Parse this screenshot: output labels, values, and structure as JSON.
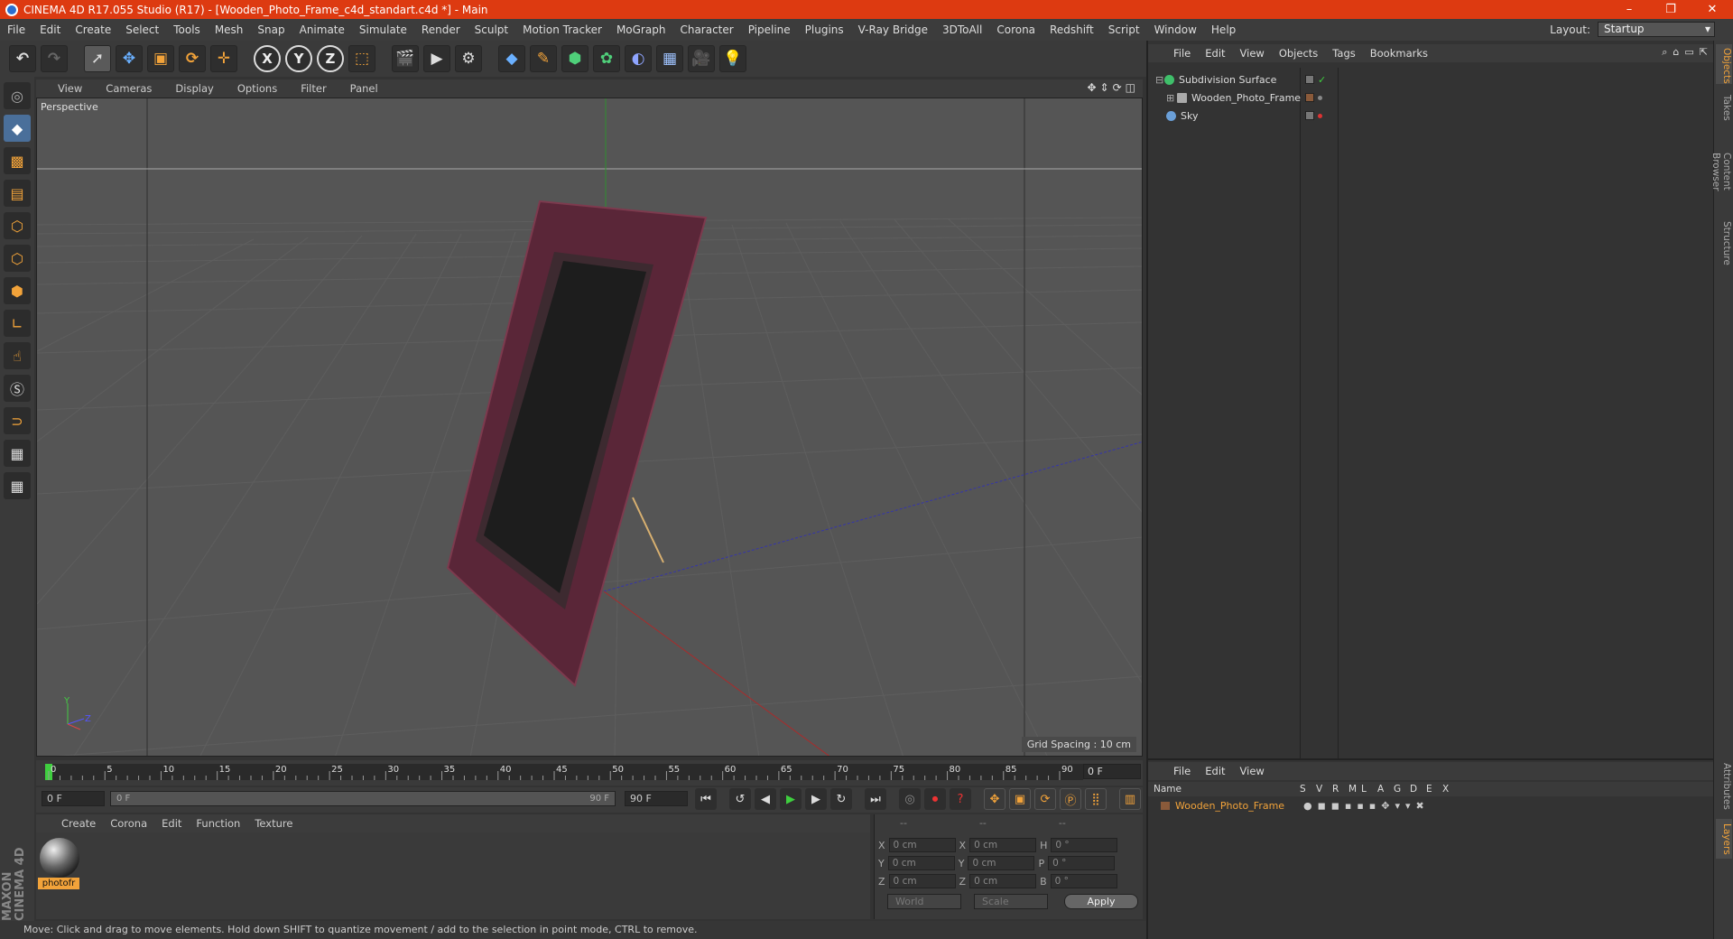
{
  "titlebar": {
    "title": "CINEMA 4D R17.055 Studio (R17) - [Wooden_Photo_Frame_c4d_standart.c4d *] - Main",
    "minimize": "–",
    "maximize": "❐",
    "close": "✕"
  },
  "menubar": {
    "items": [
      "File",
      "Edit",
      "Create",
      "Select",
      "Tools",
      "Mesh",
      "Snap",
      "Animate",
      "Simulate",
      "Render",
      "Sculpt",
      "Motion Tracker",
      "MoGraph",
      "Character",
      "Pipeline",
      "Plugins",
      "V-Ray Bridge",
      "3DToAll",
      "Corona",
      "Redshift",
      "Script",
      "Window",
      "Help"
    ],
    "layout_label": "Layout:",
    "layout_value": "Startup"
  },
  "toolbar": {
    "axis_x": "X",
    "axis_y": "Y",
    "axis_z": "Z"
  },
  "viewport": {
    "menu": [
      "View",
      "Cameras",
      "Display",
      "Options",
      "Filter",
      "Panel"
    ],
    "label": "Perspective",
    "grid_spacing": "Grid Spacing : 10 cm",
    "axis_y": "Y",
    "axis_z": "Z"
  },
  "timeline": {
    "ticks": [
      "0",
      "5",
      "10",
      "15",
      "20",
      "25",
      "30",
      "35",
      "40",
      "45",
      "50",
      "55",
      "60",
      "65",
      "70",
      "75",
      "80",
      "85",
      "90"
    ],
    "current_frame": "0 F"
  },
  "transport": {
    "start_frame": "0 F",
    "slider_left": "0 F",
    "slider_right": "90 F",
    "end_frame": "90 F"
  },
  "material": {
    "menu": [
      "Create",
      "Corona",
      "Edit",
      "Function",
      "Texture"
    ],
    "name": "photofr"
  },
  "coords": {
    "header": [
      "--",
      "--",
      "--"
    ],
    "rows": [
      {
        "a": "X",
        "v1": "0 cm",
        "b": "X",
        "v2": "0 cm",
        "c": "H",
        "v3": "0 °"
      },
      {
        "a": "Y",
        "v1": "0 cm",
        "b": "Y",
        "v2": "0 cm",
        "c": "P",
        "v3": "0 °"
      },
      {
        "a": "Z",
        "v1": "0 cm",
        "b": "Z",
        "v2": "0 cm",
        "c": "B",
        "v3": "0 °"
      }
    ],
    "mode": "World",
    "transform": "Scale",
    "apply": "Apply"
  },
  "status": {
    "text": "Move: Click and drag to move elements. Hold down SHIFT to quantize movement / add to the selection in point mode, CTRL to remove."
  },
  "logo": {
    "text": "MAXON CINEMA 4D"
  },
  "objects": {
    "menu": [
      "File",
      "Edit",
      "View",
      "Objects",
      "Tags",
      "Bookmarks"
    ],
    "rows": [
      {
        "name": "Subdivision Surface",
        "color": "#3fbf6a"
      },
      {
        "name": "Wooden_Photo_Frame",
        "color": "#aaaaaa"
      },
      {
        "name": "Sky",
        "color": "#6a9fd8"
      }
    ]
  },
  "layers": {
    "menu": [
      "File",
      "Edit",
      "View"
    ],
    "columns": [
      "Name",
      "S",
      "V",
      "R",
      "M",
      "L",
      "A",
      "G",
      "D",
      "E",
      "X"
    ],
    "row_name": "Wooden_Photo_Frame"
  },
  "rightstrip": {
    "tabs": [
      "Objects",
      "Takes",
      "Content Browser",
      "Structure",
      "Attributes",
      "Layers"
    ]
  }
}
